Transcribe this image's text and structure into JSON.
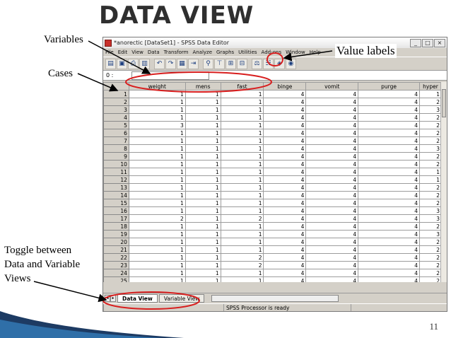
{
  "slide": {
    "title": "DATA VIEW",
    "page_number": "11",
    "annotations": {
      "variables": "Variables",
      "cases": "Cases",
      "value_labels": "Value labels",
      "toggle_line1": "Toggle between",
      "toggle_line2": "Data and Variable",
      "toggle_line3": "Views"
    }
  },
  "window": {
    "title": "*anorectic [DataSet1] - SPSS Data Editor",
    "controls": [
      "_",
      "□",
      "×"
    ],
    "menu": [
      "File",
      "Edit",
      "View",
      "Data",
      "Transform",
      "Analyze",
      "Graphs",
      "Utilities",
      "Add-ons",
      "Window",
      "Help"
    ],
    "cell_ref_label": "0 :",
    "tabs": {
      "data_view": "Data View",
      "variable_view": "Variable View"
    },
    "status": "SPSS Processor is ready"
  },
  "grid": {
    "columns": [
      "weight",
      "mens",
      "fast",
      "binge",
      "vomit",
      "purge",
      "hyper"
    ],
    "rows": [
      [
        "1",
        "1",
        "1",
        "1",
        "4",
        "4",
        "4",
        "1"
      ],
      [
        "2",
        "1",
        "1",
        "1",
        "4",
        "4",
        "4",
        "2"
      ],
      [
        "3",
        "1",
        "1",
        "1",
        "4",
        "4",
        "4",
        "3"
      ],
      [
        "4",
        "1",
        "1",
        "1",
        "4",
        "4",
        "4",
        "2"
      ],
      [
        "5",
        "3",
        "1",
        "1",
        "4",
        "4",
        "4",
        "2"
      ],
      [
        "6",
        "1",
        "1",
        "1",
        "4",
        "4",
        "4",
        "2"
      ],
      [
        "7",
        "1",
        "1",
        "1",
        "4",
        "4",
        "4",
        "2"
      ],
      [
        "8",
        "1",
        "1",
        "1",
        "4",
        "4",
        "4",
        "3"
      ],
      [
        "9",
        "1",
        "1",
        "1",
        "4",
        "4",
        "4",
        "2"
      ],
      [
        "10",
        "1",
        "1",
        "1",
        "4",
        "4",
        "4",
        "2"
      ],
      [
        "11",
        "1",
        "1",
        "1",
        "4",
        "4",
        "4",
        "1"
      ],
      [
        "12",
        "1",
        "1",
        "1",
        "4",
        "4",
        "4",
        "1"
      ],
      [
        "13",
        "1",
        "1",
        "1",
        "4",
        "4",
        "4",
        "2"
      ],
      [
        "14",
        "1",
        "1",
        "1",
        "4",
        "4",
        "4",
        "2"
      ],
      [
        "15",
        "1",
        "1",
        "1",
        "4",
        "4",
        "4",
        "2"
      ],
      [
        "16",
        "1",
        "1",
        "1",
        "4",
        "4",
        "4",
        "3"
      ],
      [
        "17",
        "2",
        "1",
        "2",
        "4",
        "4",
        "4",
        "3"
      ],
      [
        "18",
        "1",
        "1",
        "1",
        "4",
        "4",
        "4",
        "2"
      ],
      [
        "19",
        "1",
        "1",
        "1",
        "4",
        "4",
        "4",
        "3"
      ],
      [
        "20",
        "1",
        "1",
        "1",
        "4",
        "4",
        "4",
        "2"
      ],
      [
        "21",
        "1",
        "1",
        "1",
        "4",
        "4",
        "4",
        "2"
      ],
      [
        "22",
        "1",
        "1",
        "2",
        "4",
        "4",
        "4",
        "2"
      ],
      [
        "23",
        "1",
        "1",
        "2",
        "4",
        "4",
        "4",
        "2"
      ],
      [
        "24",
        "1",
        "1",
        "1",
        "4",
        "4",
        "4",
        "2"
      ],
      [
        "25",
        "1",
        "1",
        "1",
        "4",
        "4",
        "4",
        "2"
      ],
      [
        "26",
        "1",
        "1",
        "2",
        "4",
        "4",
        "2",
        "3"
      ]
    ]
  },
  "colors": {
    "annotation_red": "#d81e1e"
  }
}
